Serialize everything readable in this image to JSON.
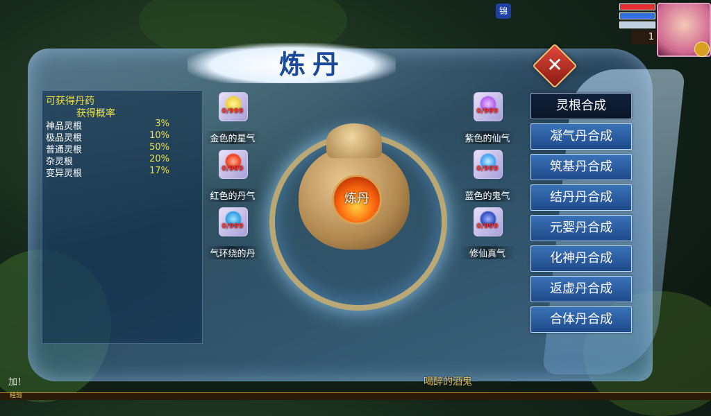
{
  "window": {
    "title": "炼丹",
    "close_symbol": "✕"
  },
  "info": {
    "heading": "可获得丹药",
    "subheading": "获得概率",
    "rates": [
      {
        "name": "神品灵根",
        "percent": "3%"
      },
      {
        "name": "极品灵根",
        "percent": "10%"
      },
      {
        "name": "普通灵根",
        "percent": "50%"
      },
      {
        "name": "杂灵根",
        "percent": "20%"
      },
      {
        "name": "变异灵根",
        "percent": "17%"
      }
    ]
  },
  "materials": [
    {
      "name": "金色的星气",
      "count": "0/999",
      "color": "#f0d040",
      "icon": "gold-star-qi-icon"
    },
    {
      "name": "紫色的仙气",
      "count": "0/999",
      "color": "#b060f0",
      "icon": "purple-immortal-qi-icon"
    },
    {
      "name": "红色的丹气",
      "count": "0/999",
      "color": "#f04020",
      "icon": "red-pill-qi-icon"
    },
    {
      "name": "蓝色的鬼气",
      "count": "0/999",
      "color": "#40a0f0",
      "icon": "blue-ghost-qi-icon"
    },
    {
      "name": "气环绕的丹",
      "count": "0/999",
      "color": "#30a0e0",
      "icon": "qi-ring-pill-icon"
    },
    {
      "name": "修仙真气",
      "count": "0/999",
      "color": "#3050c0",
      "icon": "cultivation-qi-icon"
    }
  ],
  "cauldron": {
    "label": "炼丹",
    "icon": "alchemy-cauldron-icon"
  },
  "menu": [
    {
      "label": "灵根合成",
      "active": true
    },
    {
      "label": "凝气丹合成",
      "active": false
    },
    {
      "label": "筑基丹合成",
      "active": false
    },
    {
      "label": "结丹丹合成",
      "active": false
    },
    {
      "label": "元婴丹合成",
      "active": false
    },
    {
      "label": "化神丹合成",
      "active": false
    },
    {
      "label": "返虚丹合成",
      "active": false
    },
    {
      "label": "合体丹合成",
      "active": false
    }
  ],
  "player": {
    "level": "1",
    "hp_color": "#e03030",
    "mp_color": "#3070e0",
    "badge": "锦"
  },
  "hud": {
    "exp_label": "经验",
    "npc_name": "喝醉的酒鬼",
    "chat_snippet": "加！"
  },
  "colors": {
    "accent_gold": "#f0e040",
    "button_blue": "#2a5ea0",
    "title_blue": "#1c4a9a"
  }
}
